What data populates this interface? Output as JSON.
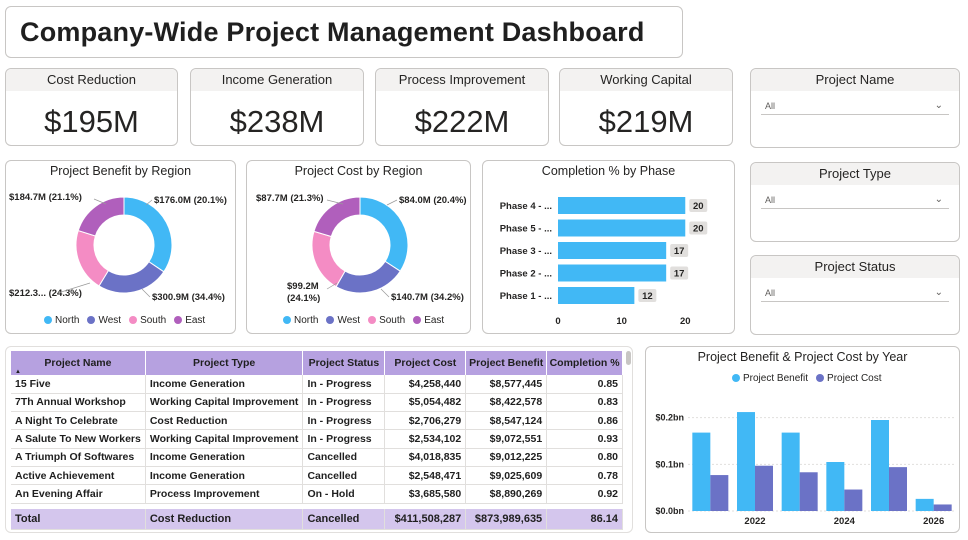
{
  "header": {
    "title": "Company-Wide Project Management Dashboard"
  },
  "kpis": [
    {
      "label": "Cost Reduction",
      "value": "$195M"
    },
    {
      "label": "Income Generation",
      "value": "$238M"
    },
    {
      "label": "Process Improvement",
      "value": "$222M"
    },
    {
      "label": "Working Capital",
      "value": "$219M"
    }
  ],
  "slicers": [
    {
      "title": "Project Name",
      "selected": "All"
    },
    {
      "title": "Project Type",
      "selected": "All"
    },
    {
      "title": "Project Status",
      "selected": "All"
    }
  ],
  "colors": {
    "north": "#41b8f5",
    "west": "#6b72c6",
    "south": "#f48cc4",
    "east": "#b05fbc",
    "bar": "#41b8f5",
    "benefit": "#41b8f5",
    "cost": "#6b72c6",
    "header": "#b6a1e0",
    "total": "#d4c6ed"
  },
  "benefit_by_region": {
    "title": "Project Benefit by Region",
    "legend": [
      "North",
      "West",
      "South",
      "East"
    ],
    "labels": {
      "north": "$300.9M (34.4%)",
      "west": "$212.3... (24.3%)",
      "south": "$184.7M (21.1%)",
      "east": "$176.0M (20.1%)"
    }
  },
  "cost_by_region": {
    "title": "Project Cost by Region",
    "legend": [
      "North",
      "West",
      "South",
      "East"
    ],
    "labels": {
      "north": "$140.7M (34.2%)",
      "west_1": "$99.2M",
      "west_2": "(24.1%)",
      "south": "$87.7M (21.3%)",
      "east": "$84.0M (20.4%)"
    }
  },
  "completion_by_phase": {
    "title": "Completion % by Phase",
    "axis_ticks": [
      "0",
      "10",
      "20"
    ]
  },
  "table": {
    "columns": [
      "Project Name",
      "Project Type",
      "Project Status",
      "Project Cost",
      "Project Benefit",
      "Completion %"
    ],
    "sort_indicator": "▲",
    "rows": [
      [
        "15 Five",
        "Income Generation",
        "In - Progress",
        "$4,258,440",
        "$8,577,445",
        "0.85"
      ],
      [
        "7Th Annual Workshop",
        "Working Capital Improvement",
        "In - Progress",
        "$5,054,482",
        "$8,422,578",
        "0.83"
      ],
      [
        "A Night To Celebrate",
        "Cost Reduction",
        "In - Progress",
        "$2,706,279",
        "$8,547,124",
        "0.86"
      ],
      [
        "A Salute To New Workers",
        "Working Capital Improvement",
        "In - Progress",
        "$2,534,102",
        "$9,072,551",
        "0.93"
      ],
      [
        "A Triumph Of Softwares",
        "Income Generation",
        "Cancelled",
        "$4,018,835",
        "$9,012,225",
        "0.80"
      ],
      [
        "Active Achievement",
        "Income Generation",
        "Cancelled",
        "$2,548,471",
        "$9,025,609",
        "0.78"
      ],
      [
        "An Evening Affair",
        "Process Improvement",
        "On - Hold",
        "$3,685,580",
        "$8,890,269",
        "0.92"
      ]
    ],
    "total": [
      "Total",
      "Cost Reduction",
      "Cancelled",
      "$411,508,287",
      "$873,989,635",
      "86.14"
    ]
  },
  "benefit_cost_by_year": {
    "title": "Project Benefit & Project Cost by Year",
    "legend": [
      "Project Benefit",
      "Project Cost"
    ],
    "y_ticks": [
      "$0.0bn",
      "$0.1bn",
      "$0.2bn"
    ],
    "x_ticks": [
      "2022",
      "2024",
      "2026"
    ]
  },
  "chart_data": [
    {
      "type": "pie",
      "title": "Project Benefit by Region",
      "categories": [
        "North",
        "West",
        "South",
        "East"
      ],
      "values": [
        300.9,
        212.3,
        184.7,
        176.0
      ],
      "percents": [
        34.4,
        24.3,
        21.1,
        20.1
      ],
      "unit": "$M",
      "legend": "bottom"
    },
    {
      "type": "pie",
      "title": "Project Cost by Region",
      "categories": [
        "North",
        "West",
        "South",
        "East"
      ],
      "values": [
        140.7,
        99.2,
        87.7,
        84.0
      ],
      "percents": [
        34.2,
        24.1,
        21.3,
        20.4
      ],
      "unit": "$M",
      "legend": "bottom"
    },
    {
      "type": "bar",
      "orientation": "horizontal",
      "title": "Completion % by Phase",
      "categories": [
        "Phase 4 - ...",
        "Phase 5 - ...",
        "Phase 3 - ...",
        "Phase 2 - ...",
        "Phase 1 - ..."
      ],
      "values": [
        20,
        20,
        17,
        17,
        12
      ],
      "xlim": [
        0,
        22
      ]
    },
    {
      "type": "bar",
      "title": "Project Benefit & Project Cost by Year",
      "categories": [
        "2021",
        "2022",
        "2023",
        "2024",
        "2025",
        "2026"
      ],
      "x_tick_labels": [
        "2022",
        "2024",
        "2026"
      ],
      "series": [
        {
          "name": "Project Benefit",
          "values": [
            0.168,
            0.212,
            0.168,
            0.105,
            0.195,
            0.026
          ]
        },
        {
          "name": "Project Cost",
          "values": [
            0.077,
            0.097,
            0.083,
            0.046,
            0.094,
            0.014
          ]
        }
      ],
      "unit": "bn",
      "ylim": [
        0,
        0.24
      ],
      "legend": "top"
    }
  ]
}
